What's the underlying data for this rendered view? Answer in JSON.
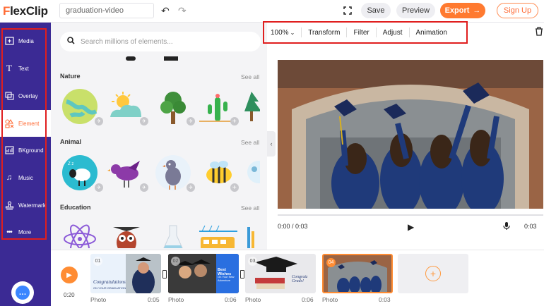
{
  "app": {
    "logo_first": "F",
    "logo_rest": "lexClip"
  },
  "header": {
    "project_name": "graduation-video",
    "save_label": "Save",
    "preview_label": "Preview",
    "export_label": "Export",
    "signup_label": "Sign Up"
  },
  "sidebar": {
    "items": [
      {
        "label": "Media",
        "icon": "media-icon"
      },
      {
        "label": "Text",
        "icon": "text-icon"
      },
      {
        "label": "Overlay",
        "icon": "overlay-icon"
      },
      {
        "label": "Element",
        "icon": "element-icon",
        "active": true
      },
      {
        "label": "BKground",
        "icon": "background-icon"
      },
      {
        "label": "Music",
        "icon": "music-icon"
      },
      {
        "label": "Watermark",
        "icon": "watermark-icon"
      },
      {
        "label": "More",
        "icon": "more-icon"
      }
    ]
  },
  "panel": {
    "search_placeholder": "Search millions of elements...",
    "sections": [
      {
        "title": "Nature",
        "see_all": "See all"
      },
      {
        "title": "Animal",
        "see_all": "See all"
      },
      {
        "title": "Education",
        "see_all": "See all"
      }
    ]
  },
  "toolbar": {
    "zoom": "100%",
    "transform": "Transform",
    "filter": "Filter",
    "adjust": "Adjust",
    "animation": "Animation"
  },
  "player": {
    "time": "0:00 / 0:03",
    "duration": "0:03"
  },
  "timeline": {
    "current_time": "0:20",
    "clips": [
      {
        "num": "01",
        "label": "Photo",
        "duration": "0:05",
        "caption": "Congratulations",
        "subcaption": "ON YOUR GRADUATION"
      },
      {
        "num": "02",
        "label": "Photo",
        "duration": "0:06",
        "caption": "Best Wishes",
        "subcaption": "On Your New Adventure"
      },
      {
        "num": "03",
        "label": "Photo",
        "duration": "0:06",
        "caption": "Congratz Grads!",
        "subcaption": ""
      },
      {
        "num": "04",
        "label": "Photo",
        "duration": "0:03",
        "caption": "",
        "subcaption": ""
      }
    ]
  },
  "colors": {
    "accent": "#ff7a30",
    "nav": "#3b2a94",
    "highlight": "#e01e1e"
  }
}
